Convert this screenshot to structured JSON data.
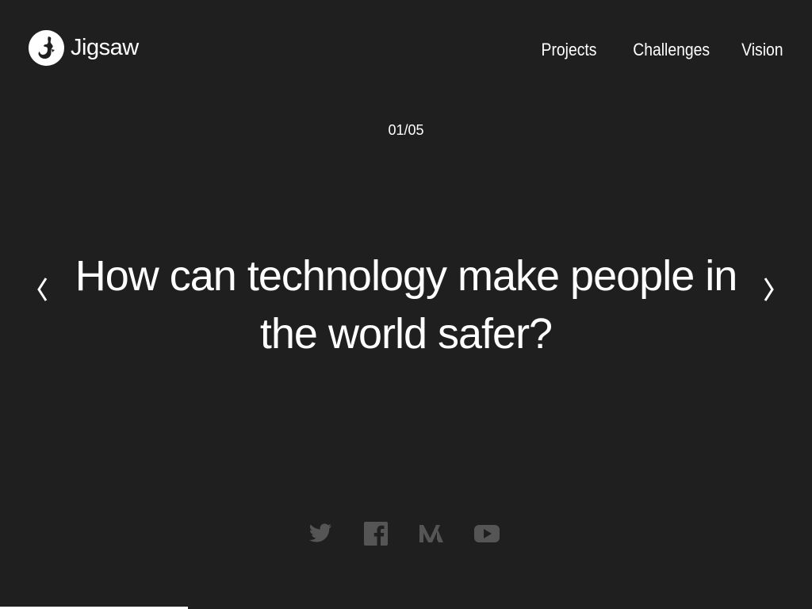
{
  "brand": {
    "name": "Jigsaw"
  },
  "nav": {
    "items": [
      {
        "label": "Projects"
      },
      {
        "label": "Challenges"
      },
      {
        "label": "Vision"
      }
    ]
  },
  "slider": {
    "counter": "01/05",
    "current": 1,
    "total": 5,
    "title": "How can technology make people in the world safer?",
    "prev_icon": "chevron-left-icon",
    "next_icon": "chevron-right-icon"
  },
  "social": {
    "links": [
      {
        "icon": "twitter-icon"
      },
      {
        "icon": "facebook-icon"
      },
      {
        "icon": "medium-icon"
      },
      {
        "icon": "youtube-icon"
      }
    ],
    "color": "#555555"
  },
  "colors": {
    "background": "#1f1f1f",
    "text": "#ffffff"
  }
}
